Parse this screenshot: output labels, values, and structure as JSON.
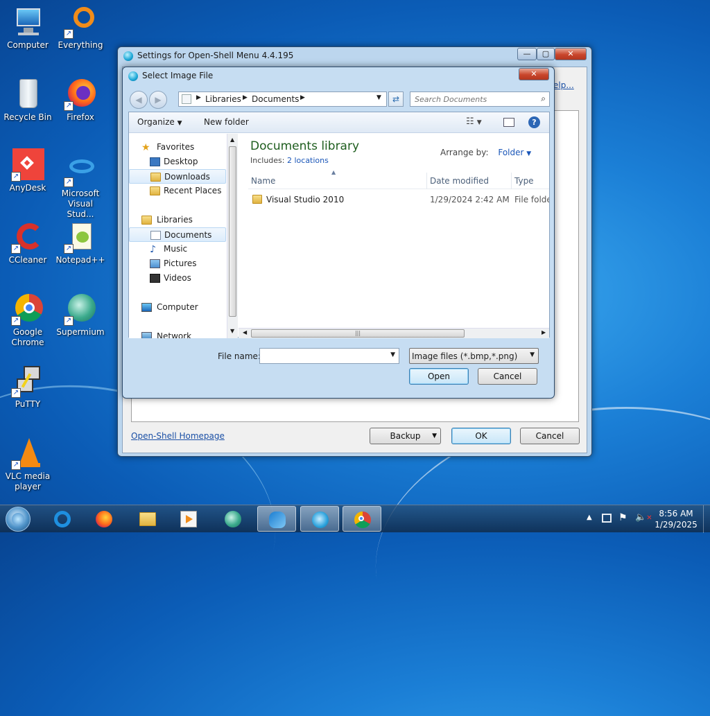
{
  "desktop": {
    "icons": [
      {
        "label": "Computer",
        "icon": "computer-icon"
      },
      {
        "label": "Everything",
        "icon": "everything-icon"
      },
      {
        "label": "Recycle Bin",
        "icon": "recycle-bin-icon"
      },
      {
        "label": "Firefox",
        "icon": "firefox-icon"
      },
      {
        "label": "AnyDesk",
        "icon": "anydesk-icon"
      },
      {
        "label": "Microsoft Visual Stud...",
        "icon": "visual-studio-icon"
      },
      {
        "label": "CCleaner",
        "icon": "ccleaner-icon"
      },
      {
        "label": "Notepad++",
        "icon": "notepadpp-icon"
      },
      {
        "label": "Google Chrome",
        "icon": "chrome-icon"
      },
      {
        "label": "Supermium",
        "icon": "supermium-icon"
      },
      {
        "label": "PuTTY",
        "icon": "putty-icon"
      },
      {
        "label": "VLC media player",
        "icon": "vlc-icon"
      }
    ]
  },
  "settings_window": {
    "title": "Settings for Open-Shell Menu 4.4.195",
    "help_link": "elp...",
    "homepage_link": "Open-Shell Homepage",
    "backup_label": "Backup",
    "ok_label": "OK",
    "cancel_label": "Cancel"
  },
  "dialog": {
    "title": "Select Image File",
    "breadcrumb": [
      "Libraries",
      "Documents"
    ],
    "search_placeholder": "Search Documents",
    "organize_label": "Organize",
    "new_folder_label": "New folder",
    "library_title": "Documents library",
    "includes_label": "Includes:",
    "includes_link": "2 locations",
    "arrange_label": "Arrange by:",
    "arrange_value": "Folder",
    "nav": {
      "favorites": "Favorites",
      "desktop": "Desktop",
      "downloads": "Downloads",
      "recent": "Recent Places",
      "libraries": "Libraries",
      "documents": "Documents",
      "music": "Music",
      "pictures": "Pictures",
      "videos": "Videos",
      "computer": "Computer",
      "network": "Network"
    },
    "columns": [
      "Name",
      "Date modified",
      "Type"
    ],
    "files": [
      {
        "name": "Visual Studio 2010",
        "date": "1/29/2024 2:42 AM",
        "type": "File folder"
      }
    ],
    "filename_label": "File name:",
    "filename_value": "",
    "filter_value": "Image files (*.bmp,*.png)",
    "open_label": "Open",
    "cancel_label": "Cancel"
  },
  "taskbar": {
    "time": "8:56 AM",
    "date": "1/29/2025"
  }
}
